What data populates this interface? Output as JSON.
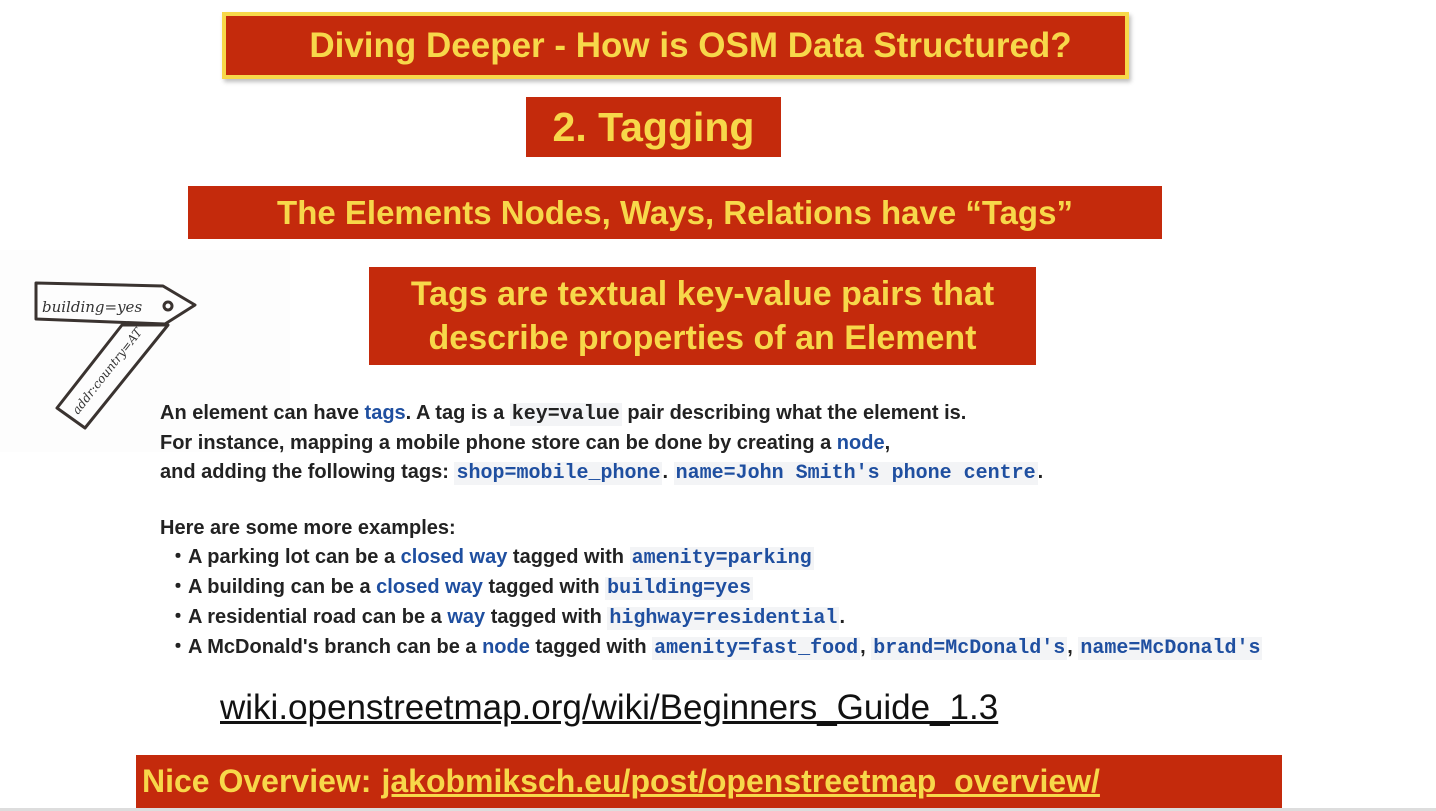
{
  "title": "Diving Deeper - How is OSM Data Structured?",
  "subtitle": "2. Tagging",
  "elements_banner": "The Elements Nodes, Ways, Relations have “Tags”",
  "description_banner": [
    "Tags are textual key-value pairs that",
    "describe properties of an Element"
  ],
  "sketch": {
    "tag1": "building=yes",
    "tag2": "addr:country=AT"
  },
  "body": {
    "l1_a": "An element can have ",
    "l1_link": "tags",
    "l1_b": ". A tag is a ",
    "l1_code": "key=value",
    "l1_c": " pair describing what the element is.",
    "l2_a": "For instance, mapping a mobile phone store can be done by creating a ",
    "l2_link": "node",
    "l2_b": ",",
    "l3_a": "and adding the following tags: ",
    "l3_code1": "shop=mobile_phone",
    "l3_sep": ". ",
    "l3_code2": "name=John Smith's phone centre",
    "l3_end": ".",
    "examples_heading": "Here are some more examples:",
    "bullet": "・",
    "examples": [
      {
        "a": "A parking lot can be a ",
        "link": "closed way",
        "b": " tagged with ",
        "code": "amenity=parking",
        "end": ""
      },
      {
        "a": "A building can be a ",
        "link": "closed way",
        "b": " tagged with ",
        "code": "building=yes",
        "end": ""
      },
      {
        "a": "A residential road can be a ",
        "link": "way",
        "b": " tagged with ",
        "code": "highway=residential",
        "end": "."
      },
      {
        "a": "A McDonald's branch can be a ",
        "link": "node",
        "b": " tagged with ",
        "code": "amenity=fast_food",
        "sep1": ", ",
        "code2": "brand=McDonald's",
        "sep2": ", ",
        "code3": "name=McDonald's"
      }
    ]
  },
  "wiki_link": "wiki.openstreetmap.org/wiki/Beginners_Guide_1.3",
  "bottom": {
    "label": "Nice Overview:",
    "link": "jakobmiksch.eu/post/openstreetmap_overview/"
  },
  "colors": {
    "banner": "#c42a0c",
    "banner_text": "#f7d84a",
    "link": "#1f4fa0"
  }
}
